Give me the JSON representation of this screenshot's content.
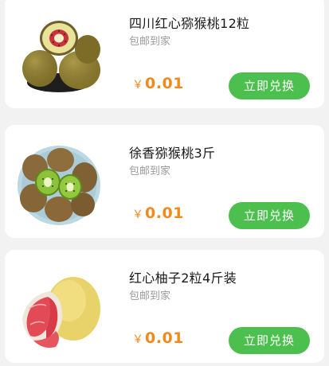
{
  "products": [
    {
      "title": "四川红心猕猴桃12粒",
      "subtitle": "包邮到家",
      "currency": "￥",
      "price": "0.01",
      "button_label": "立即兑换",
      "image_icon": "red-kiwi-image"
    },
    {
      "title": "徐香猕猴桃3斤",
      "subtitle": "包邮到家",
      "currency": "￥",
      "price": "0.01",
      "button_label": "立即兑换",
      "image_icon": "green-kiwi-image"
    },
    {
      "title": "红心柚子2粒4斤装",
      "subtitle": "包邮到家",
      "currency": "￥",
      "price": "0.01",
      "button_label": "立即兑换",
      "image_icon": "red-pomelo-image"
    }
  ],
  "colors": {
    "price": "#f08a1f",
    "button": "#4cbf4f",
    "background": "#f2f2f2"
  }
}
